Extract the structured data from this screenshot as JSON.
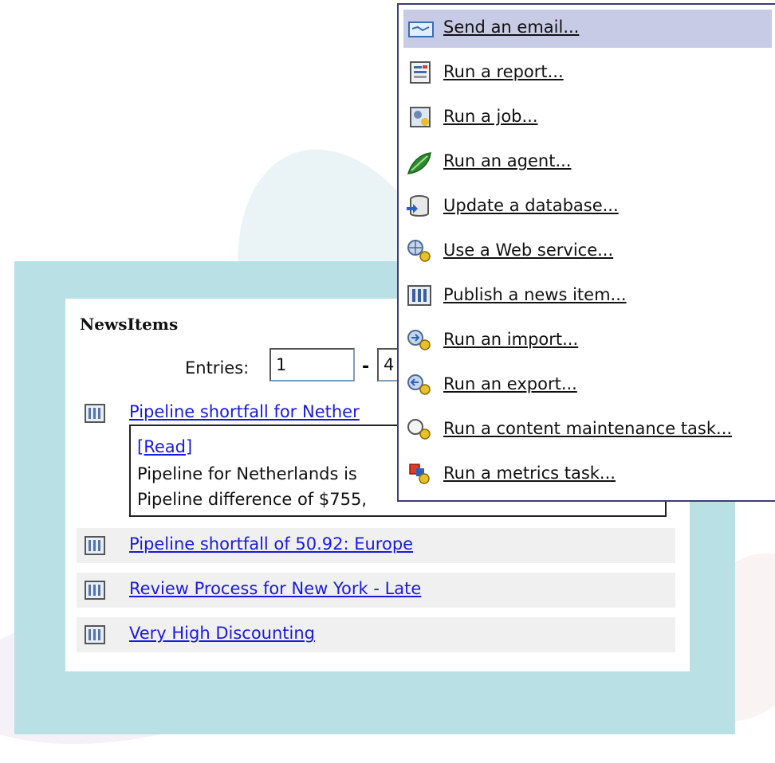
{
  "news": {
    "title": "NewsItems",
    "entries_label": "Entries:",
    "entries_from": "1",
    "entries_to": "4",
    "separator": "-",
    "items": [
      {
        "label": "Pipeline shortfall for Nether"
      },
      {
        "label": "Pipeline shortfall of 50.92: Europe"
      },
      {
        "label": "Review Process for New York - Late"
      },
      {
        "label": "Very High Discounting"
      }
    ],
    "detail": {
      "read_label": "[Read]",
      "line1": "Pipeline for Netherlands is",
      "line2": "Pipeline difference of $755,"
    }
  },
  "menu": {
    "items": [
      {
        "label": "Send an email...",
        "icon": "email-icon",
        "active": true
      },
      {
        "label": "Run a report...",
        "icon": "report-icon"
      },
      {
        "label": "Run a job...",
        "icon": "job-icon"
      },
      {
        "label": "Run an agent...",
        "icon": "agent-icon"
      },
      {
        "label": "Update a database...",
        "icon": "database-icon"
      },
      {
        "label": "Use a Web service...",
        "icon": "web-service-icon"
      },
      {
        "label": "Publish a news item...",
        "icon": "news-item-icon"
      },
      {
        "label": "Run an import...",
        "icon": "import-icon"
      },
      {
        "label": "Run an export...",
        "icon": "export-icon"
      },
      {
        "label": "Run a content maintenance task...",
        "icon": "maintenance-icon"
      },
      {
        "label": "Run a metrics task...",
        "icon": "metrics-icon"
      }
    ]
  },
  "colors": {
    "portal_bg": "#b9e0e4",
    "link": "#1a1ad8",
    "menu_highlight": "#c8cbe6"
  }
}
